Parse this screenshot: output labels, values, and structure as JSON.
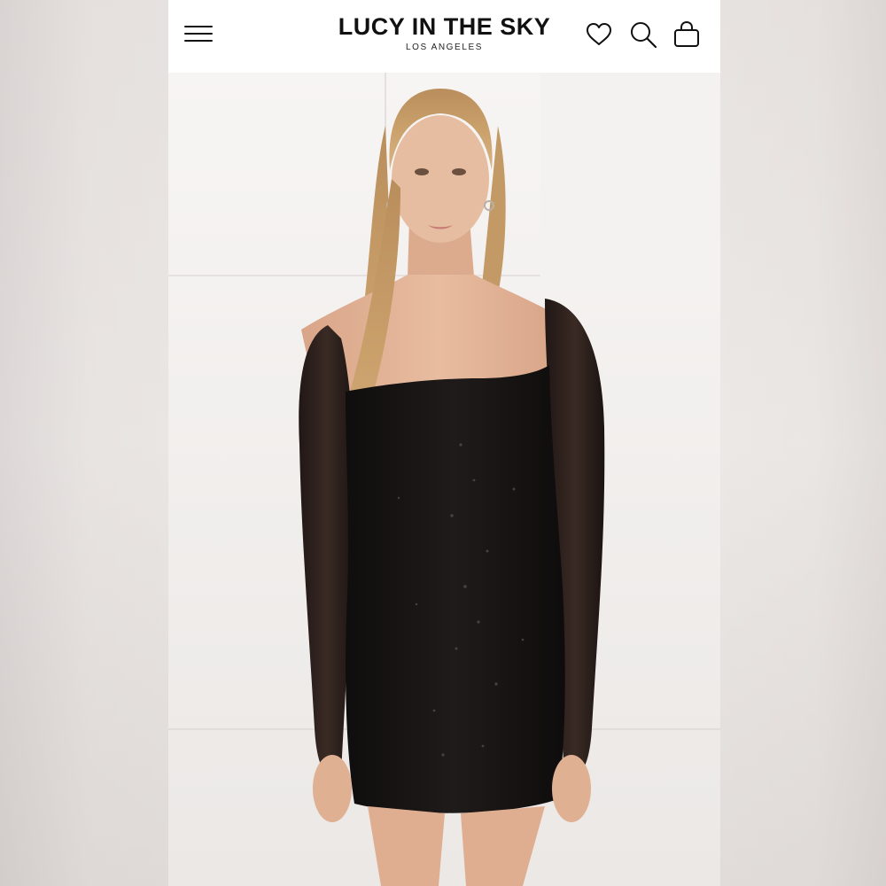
{
  "header": {
    "brand_name": "LUCY IN THE SKY",
    "brand_location": "LOS ANGELES",
    "icons": {
      "menu": "hamburger-menu-icon",
      "wishlist": "heart-icon",
      "search": "search-icon",
      "cart": "shopping-bag-icon"
    }
  },
  "product_image": {
    "subject": "model wearing black sequin long-sleeve mini dress",
    "colors": {
      "dress": "#1a1716",
      "background_wall": "#f2f0ee",
      "hair": "#c9a06a",
      "skin": "#e2b395"
    }
  }
}
